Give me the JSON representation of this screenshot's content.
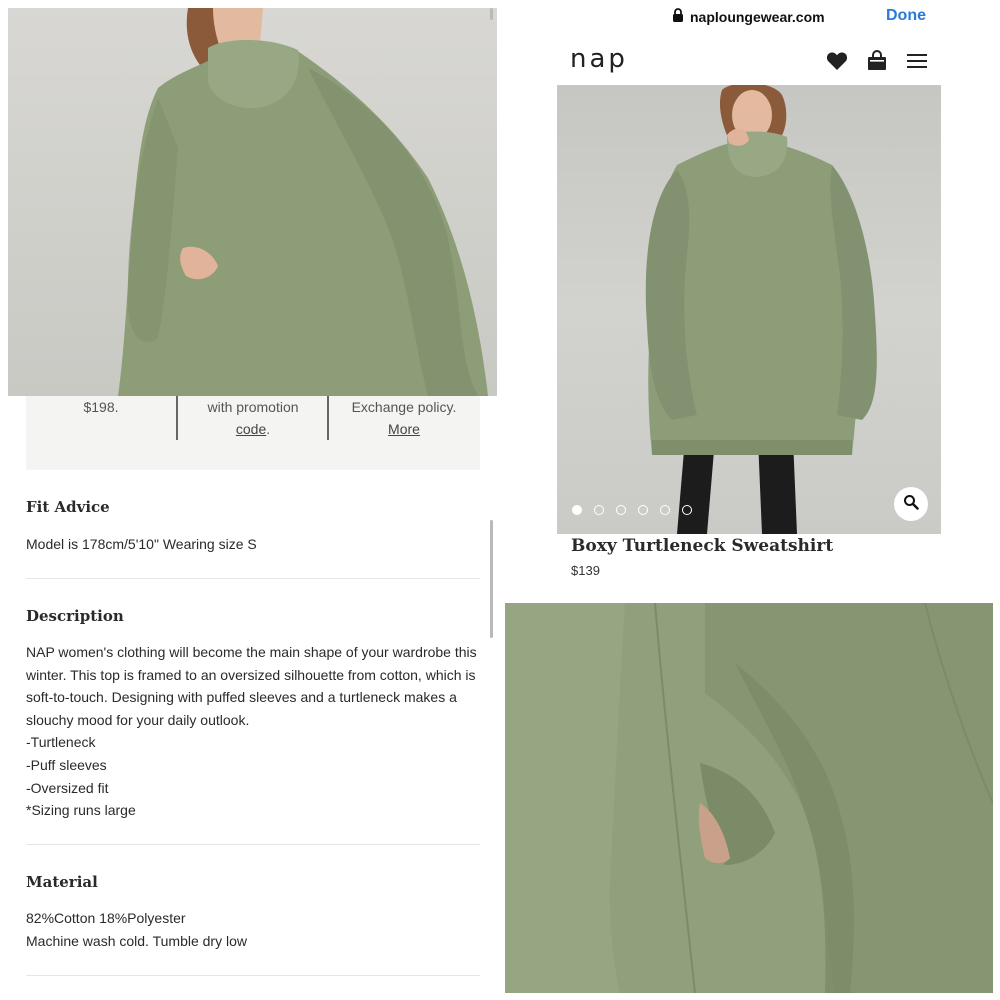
{
  "browser": {
    "url": "naploungewear.com",
    "done_label": "Done"
  },
  "header": {
    "logo": "nap",
    "icons": [
      "heart-icon",
      "shopping-bag-icon",
      "menu-icon"
    ]
  },
  "product": {
    "title": "Boxy Turtleneck Sweatshirt",
    "price": "$139",
    "carousel_total": 6,
    "carousel_active": 1
  },
  "promo": {
    "col1_line": "$198.",
    "col2_line1": "with promotion",
    "col2_link": "code",
    "col2_after": ".",
    "col3_line1": "Exchange policy.",
    "col3_link": "More"
  },
  "fit": {
    "title": "Fit Advice",
    "text": "Model is 178cm/5'10\" Wearing size S"
  },
  "description": {
    "title": "Description",
    "lines": [
      "NAP women's clothing will become the main shape of your wardrobe this",
      "winter. This top is framed to an oversized silhouette from cotton, which is",
      "soft-to-touch. Designing with puffed sleeves and a turtleneck makes a",
      "slouchy mood for your daily outlook.",
      "-Turtleneck",
      "-Puff sleeves",
      "-Oversized fit",
      "*Sizing runs large"
    ]
  },
  "material": {
    "title": "Material",
    "lines": [
      "82%Cotton 18%Polyester",
      "Machine wash cold. Tumble dry low"
    ]
  },
  "colors": {
    "sage": "#8d9d78",
    "link_blue": "#2a7bd6"
  }
}
